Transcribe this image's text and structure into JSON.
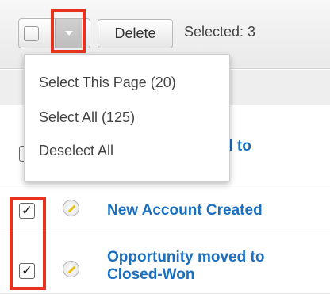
{
  "toolbar": {
    "delete_label": "Delete",
    "selected_text": "Selected: 3"
  },
  "dropdown": {
    "items": [
      {
        "label": "Select This Page (20)"
      },
      {
        "label": "Select All (125)"
      },
      {
        "label": "Deselect All"
      }
    ]
  },
  "list": {
    "rows": [
      {
        "title": "d to",
        "checked": false
      },
      {
        "title": "New Account Created",
        "checked": true
      },
      {
        "title": "Opportunity moved to\nClosed-Won",
        "checked": true
      }
    ]
  },
  "icons": {
    "checkmark": "✓",
    "edit": "pencil-icon",
    "caret": "chevron-down-icon"
  },
  "colors": {
    "highlight": "#e8321e",
    "link": "#1a6fbf"
  }
}
